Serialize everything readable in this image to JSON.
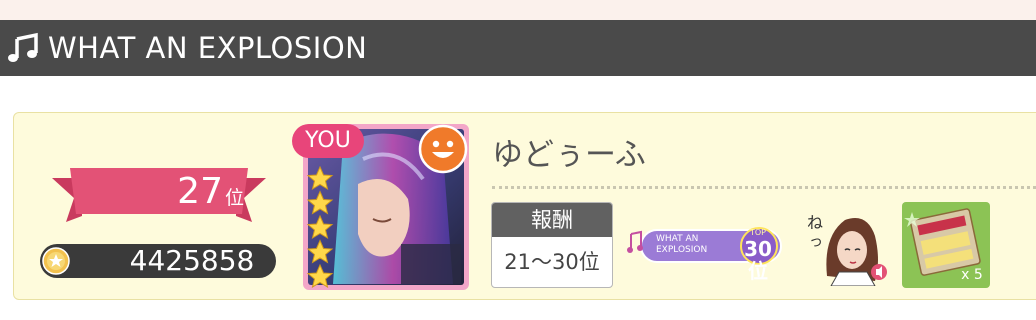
{
  "song": {
    "title": "WHAT AN EXPLOSION",
    "icon": "music-note-icon"
  },
  "ranking": {
    "rank_number": "27",
    "rank_unit": "位",
    "score": "4425858",
    "score_icon": "coin-icon"
  },
  "player": {
    "you_label": "YOU",
    "name": "ゆどぅーふ",
    "card_stars": 5
  },
  "reward": {
    "header": "報酬",
    "range": "21～30位",
    "badge_title_line1": "WHAT AN",
    "badge_title_line2": "EXPLOSION",
    "badge_rank_top": "TOP",
    "badge_rank_value": "30位",
    "ticket_count": "x 5",
    "colors": {
      "ribbon": "#e35276",
      "badge": "#9b7bd6",
      "ticket_bg": "#7dbb3e"
    }
  }
}
